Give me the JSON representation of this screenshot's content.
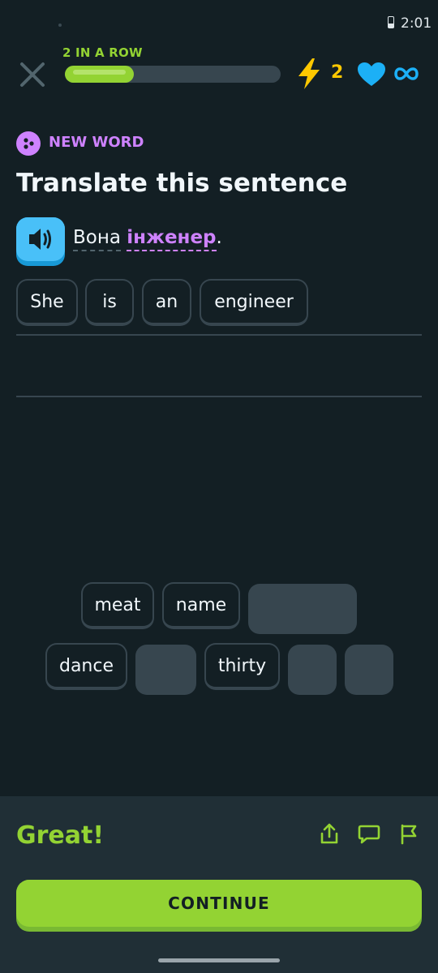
{
  "status_bar": {
    "time": "2:01"
  },
  "header": {
    "streak_label": "2 IN A ROW",
    "progress": 0.32,
    "energy_count": "2",
    "icons": [
      "close-icon",
      "lightning-icon",
      "heart-icon",
      "infinity-icon"
    ]
  },
  "challenge": {
    "badge_label": "NEW WORD",
    "title": "Translate this sentence",
    "prompt_words": [
      "Вона",
      "інженер"
    ],
    "prompt_punctuation": ".",
    "answer_chips": [
      "She",
      "is",
      "an",
      "engineer"
    ]
  },
  "word_bank": {
    "row1": [
      "meat",
      "name"
    ],
    "row2": [
      "dance",
      "thirty"
    ]
  },
  "feedback": {
    "message": "Great!",
    "continue_label": "CONTINUE",
    "icons": [
      "share-icon",
      "comment-icon",
      "report-flag-icon"
    ]
  },
  "colors": {
    "background": "#131f24",
    "accent_green": "#93d333",
    "new_word_purple": "#ce82ff",
    "speaker_blue": "#49c0f8",
    "energy_yellow": "#ffc800",
    "heart_blue": "#1cb0f6"
  }
}
